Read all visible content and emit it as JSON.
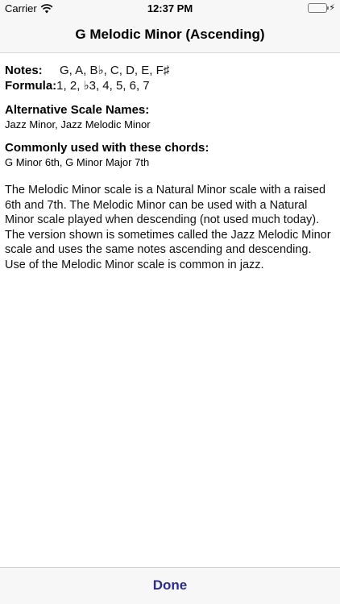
{
  "status_bar": {
    "carrier": "Carrier",
    "time": "12:37 PM",
    "wifi_icon": "wifi-icon",
    "battery_icon": "battery-icon",
    "charging_icon": "bolt-icon",
    "battery_color": "#4cd964"
  },
  "nav": {
    "title": "G Melodic Minor (Ascending)"
  },
  "scale": {
    "notes_label": "Notes:",
    "notes_value": "G, A, B♭, C, D, E, F♯",
    "formula_label": "Formula:",
    "formula_value": "1, 2, ♭3, 4, 5, 6, 7"
  },
  "alt_names": {
    "title": "Alternative Scale Names:",
    "text": "Jazz Minor, Jazz Melodic Minor"
  },
  "chords": {
    "title": "Commonly used with these chords:",
    "text": "G Minor 6th, G Minor Major 7th"
  },
  "description": "The Melodic Minor scale is a Natural Minor scale with a raised 6th and 7th. The Melodic Minor can be used with a Natural Minor scale played when descending (not used much today). The version shown is sometimes called the Jazz Melodic Minor scale and uses the same notes ascending and descending. Use of the Melodic Minor scale is common in jazz.",
  "toolbar": {
    "done_label": "Done",
    "done_color": "#2c2c8a"
  }
}
